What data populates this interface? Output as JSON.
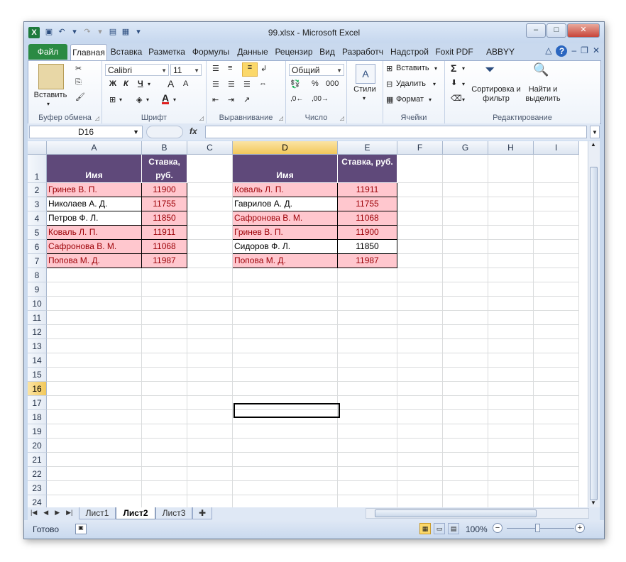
{
  "window": {
    "title": "99.xlsx - Microsoft Excel",
    "app_icon": "X",
    "buttons": {
      "minimize": "–",
      "maximize": "□",
      "close": "✕"
    }
  },
  "tabs": [
    {
      "label": "Файл",
      "kind": "file"
    },
    {
      "label": "Главная",
      "kind": "active"
    },
    {
      "label": "Вставка"
    },
    {
      "label": "Разметка"
    },
    {
      "label": "Формулы"
    },
    {
      "label": "Данные"
    },
    {
      "label": "Рецензир"
    },
    {
      "label": "Вид"
    },
    {
      "label": "Разработч"
    },
    {
      "label": "Надстрой"
    },
    {
      "label": "Foxit PDF"
    },
    {
      "label": "ABBYY PDF"
    }
  ],
  "ribbon": {
    "clipboard": {
      "label": "Буфер обмена",
      "paste": "Вставить"
    },
    "font": {
      "label": "Шрифт",
      "name": "Calibri",
      "size": "11",
      "bold": "Ж",
      "italic": "К",
      "underline": "Ч",
      "grow": "A",
      "color": "A"
    },
    "alignment": {
      "label": "Выравнивание"
    },
    "number": {
      "label": "Число",
      "format": "Общий",
      "percent": "%",
      "thousands": "000"
    },
    "styles": {
      "label": "Стили"
    },
    "cells": {
      "label": "Ячейки",
      "insert": "Вставить",
      "delete": "Удалить",
      "format": "Формат"
    },
    "editing": {
      "label": "Редактирование",
      "sort": "Сортировка и фильтр",
      "find": "Найти и выделить",
      "sum": "Σ"
    }
  },
  "formula_bar": {
    "name_box": "D16",
    "fx": "fx",
    "formula": ""
  },
  "columns": [
    "A",
    "B",
    "C",
    "D",
    "E",
    "F",
    "G",
    "H",
    "I"
  ],
  "rows": [
    "1",
    "2",
    "3",
    "4",
    "5",
    "6",
    "7",
    "8",
    "9",
    "10",
    "11",
    "12",
    "13",
    "14",
    "15",
    "16",
    "17",
    "18",
    "19",
    "20",
    "21",
    "22",
    "23",
    "24"
  ],
  "table1": {
    "header_name": "Имя",
    "header_rate": "Ставка, руб.",
    "rows": [
      {
        "name": "Гринев В. П.",
        "rate": "11900",
        "style": "pink"
      },
      {
        "name": "Николаев А. Д.",
        "rate": "11755",
        "style": "mixed"
      },
      {
        "name": "Петров Ф. Л.",
        "rate": "11850",
        "style": "mixed"
      },
      {
        "name": "Коваль Л. П.",
        "rate": "11911",
        "style": "pink"
      },
      {
        "name": "Сафронова В. М.",
        "rate": "11068",
        "style": "pink"
      },
      {
        "name": "Попова М. Д.",
        "rate": "11987",
        "style": "pink"
      }
    ]
  },
  "table2": {
    "header_name": "Имя",
    "header_rate": "Ставка, руб.",
    "rows": [
      {
        "name": "Коваль Л. П.",
        "rate": "11911",
        "style": "pink"
      },
      {
        "name": "Гаврилов А. Д.",
        "rate": "11755",
        "style": "mixed"
      },
      {
        "name": "Сафронова В. М.",
        "rate": "11068",
        "style": "pink"
      },
      {
        "name": "Гринев В. П.",
        "rate": "11900",
        "style": "pink"
      },
      {
        "name": "Сидоров Ф. Л.",
        "rate": "11850",
        "style": "white"
      },
      {
        "name": "Попова М. Д.",
        "rate": "11987",
        "style": "pink"
      }
    ]
  },
  "sheets": [
    {
      "label": "Лист1",
      "active": false
    },
    {
      "label": "Лист2",
      "active": true
    },
    {
      "label": "Лист3",
      "active": false
    }
  ],
  "status": {
    "ready": "Готово",
    "zoom": "100%"
  },
  "colors": {
    "header_bg": "#5f497a",
    "pink_bg": "#ffc7ce",
    "pink_text": "#9c0006",
    "file_tab": "#2a8a43"
  }
}
